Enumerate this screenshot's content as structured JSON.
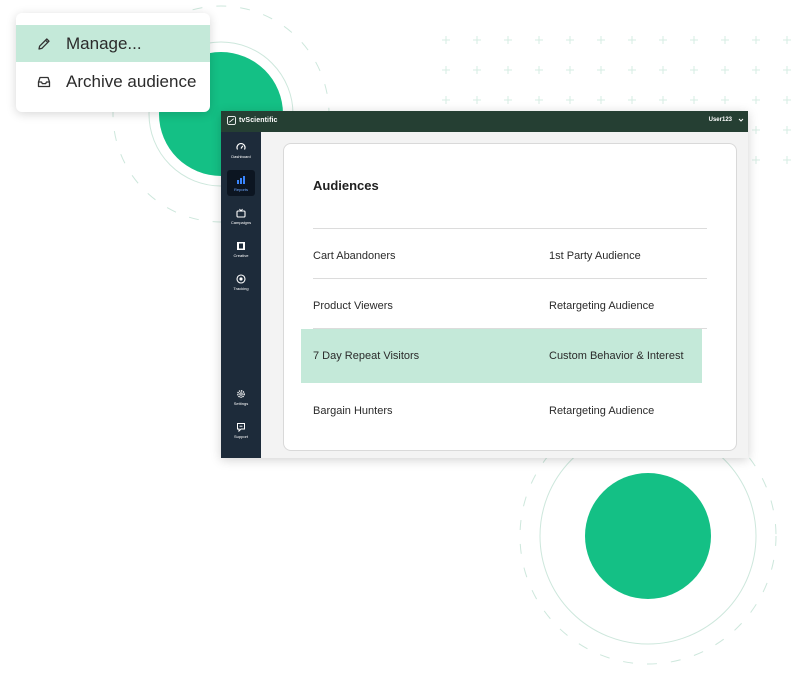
{
  "menu": {
    "items": [
      {
        "label": "Manage...",
        "icon": "pencil-icon",
        "selected": true
      },
      {
        "label": "Archive audience",
        "icon": "archive-box-icon",
        "selected": false
      }
    ]
  },
  "app": {
    "brand": "tvScientific",
    "user": "User123",
    "nav": [
      {
        "label": "Dashboard",
        "icon": "gauge-icon",
        "active": false
      },
      {
        "label": "Reports",
        "icon": "bar-chart-icon",
        "active": true
      },
      {
        "label": "Campaigns",
        "icon": "tv-icon",
        "active": false
      },
      {
        "label": "Creative",
        "icon": "film-icon",
        "active": false
      },
      {
        "label": "Tracking",
        "icon": "target-icon",
        "active": false
      },
      {
        "label": "Settings",
        "icon": "gear-icon",
        "active": false
      },
      {
        "label": "Support",
        "icon": "chat-icon",
        "active": false
      }
    ],
    "audiences": {
      "title": "Audiences",
      "rows": [
        {
          "name": "Cart Abandoners",
          "type": "1st Party Audience",
          "highlighted": false
        },
        {
          "name": "Product Viewers",
          "type": "Retargeting Audience",
          "highlighted": false
        },
        {
          "name": "7 Day Repeat Visitors",
          "type": "Custom Behavior & Interest",
          "highlighted": true
        },
        {
          "name": "Bargain Hunters",
          "type": "Retargeting Audience",
          "highlighted": false
        }
      ]
    }
  },
  "colors": {
    "accent_green": "#14c085",
    "highlight": "#c4e9d9",
    "topbar": "#253f33",
    "sidebar": "#1d2b3a"
  }
}
